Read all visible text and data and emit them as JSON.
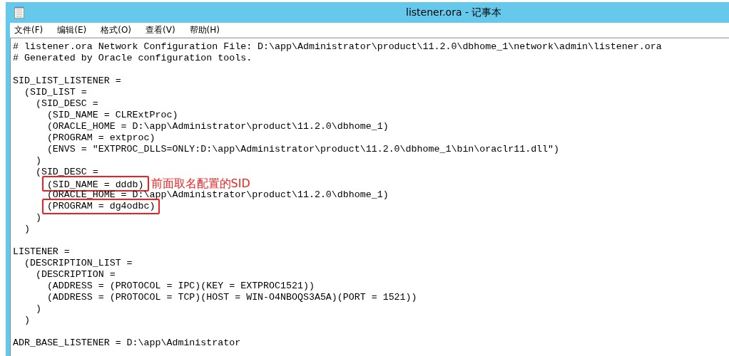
{
  "window": {
    "title": "listener.ora - 记事本"
  },
  "menu": [
    {
      "label": "文件(F)"
    },
    {
      "label": "编辑(E)"
    },
    {
      "label": "格式(O)"
    },
    {
      "label": "查看(V)"
    },
    {
      "label": "帮助(H)"
    }
  ],
  "editor": {
    "lines": [
      {
        "text": "# listener.ora Network Configuration File: D:\\app\\Administrator\\product\\11.2.0\\dbhome_1\\network\\admin\\listener.ora",
        "highlighted": false
      },
      {
        "text": "# Generated by Oracle configuration tools.",
        "highlighted": false
      },
      {
        "text": "SID_LIST_LISTENER =",
        "highlighted": false,
        "blank_line_before": true
      },
      {
        "text": "  (SID_LIST =",
        "highlighted": false
      },
      {
        "text": "    (SID_DESC =",
        "highlighted": false
      },
      {
        "text": "      (SID_NAME = CLRExtProc)",
        "highlighted": false
      },
      {
        "text": "      (ORACLE_HOME = D:\\app\\Administrator\\product\\11.2.0\\dbhome_1)",
        "highlighted": false
      },
      {
        "text": "      (PROGRAM = extproc)",
        "highlighted": false
      },
      {
        "text": "      (ENVS = \"EXTPROC_DLLS=ONLY:D:\\app\\Administrator\\product\\11.2.0\\dbhome_1\\bin\\oraclr11.dll\")",
        "highlighted": false
      },
      {
        "text": "    )",
        "highlighted": false
      },
      {
        "text": "    (SID_DESC =",
        "highlighted": false
      },
      {
        "text": "      (SID_NAME = dddb)",
        "highlighted": true,
        "note": "前面取名配置的SID"
      },
      {
        "text": "      (ORACLE_HOME = D:\\app\\Administrator\\product\\11.2.0\\dbhome_1)",
        "highlighted": false
      },
      {
        "text": "      (PROGRAM = dg4odbc)",
        "highlighted": true
      },
      {
        "text": "    )",
        "highlighted": false
      },
      {
        "text": "  )",
        "highlighted": false
      },
      {
        "text": "LISTENER =",
        "highlighted": false,
        "blank_line_before": true
      },
      {
        "text": "  (DESCRIPTION_LIST =",
        "highlighted": false
      },
      {
        "text": "    (DESCRIPTION =",
        "highlighted": false
      },
      {
        "text": "      (ADDRESS = (PROTOCOL = IPC)(KEY = EXTPROC1521))",
        "highlighted": false
      },
      {
        "text": "      (ADDRESS = (PROTOCOL = TCP)(HOST = WIN-O4NBOQS3A5A)(PORT = 1521))",
        "highlighted": false
      },
      {
        "text": "    )",
        "highlighted": false
      },
      {
        "text": "  )",
        "highlighted": false
      },
      {
        "text": "ADR_BASE_LISTENER = D:\\app\\Administrator",
        "highlighted": false,
        "blank_line_before": true
      }
    ]
  }
}
